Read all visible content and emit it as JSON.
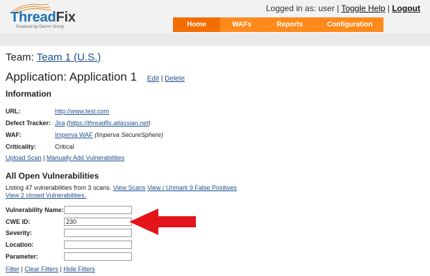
{
  "header": {
    "logo": {
      "part1": "Thread",
      "part2": "Fix",
      "subtitle": "Powered by Denim Group"
    },
    "user_text": "Logged in as: user",
    "toggle_help": "Toggle Help",
    "logout": "Logout",
    "nav": [
      {
        "label": "Home",
        "active": true
      },
      {
        "label": "WAFs",
        "active": false
      },
      {
        "label": "Reports",
        "active": false
      },
      {
        "label": "Configuration",
        "active": false
      }
    ]
  },
  "page": {
    "team_label": "Team:",
    "team_name": "Team 1 (U.S.)",
    "app_label": "Application:",
    "app_name": "Application 1",
    "edit": "Edit",
    "delete": "Delete",
    "info_title": "Information",
    "info": {
      "url": {
        "label": "URL:",
        "value": "http://www.test.com"
      },
      "defect_tracker": {
        "label": "Defect Tracker:",
        "name": "Jira",
        "url": "https://threadfix.atlassian.net"
      },
      "waf": {
        "label": "WAF:",
        "name": "Imperva WAF",
        "detail": "Imperva SecureSphere"
      },
      "criticality": {
        "label": "Criticality:",
        "value": "Critical"
      }
    },
    "actions": {
      "upload_scan": "Upload Scan",
      "manually_add": "Manually Add Vulnerabilities"
    },
    "vulns_title": "All Open Vulnerabilities",
    "listing_text": "Listing 47 vulnerabilities from 3 scans.",
    "view_scans": "View Scans",
    "view_false_positives": "View / Unmark 9 False Positives",
    "view_closed": "View 2 closed Vulnerabilities.",
    "filters": {
      "vulnerability_name": {
        "label": "Vulnerability Name:",
        "value": ""
      },
      "cwe_id": {
        "label": "CWE ID:",
        "value": "230"
      },
      "severity": {
        "label": "Severity:",
        "value": ""
      },
      "location": {
        "label": "Location:",
        "value": ""
      },
      "parameter": {
        "label": "Parameter:",
        "value": ""
      }
    },
    "filter_links": {
      "filter": "Filter",
      "clear": "Clear Filters",
      "hide": "Hide Filters"
    }
  },
  "colors": {
    "nav_orange": "#ff8a1c",
    "nav_active": "#f36e00",
    "arrow_red": "#e3151b",
    "link_blue": "#1f4f8f"
  },
  "icons": {
    "annotation_arrow": "left-pointing red arrow"
  }
}
